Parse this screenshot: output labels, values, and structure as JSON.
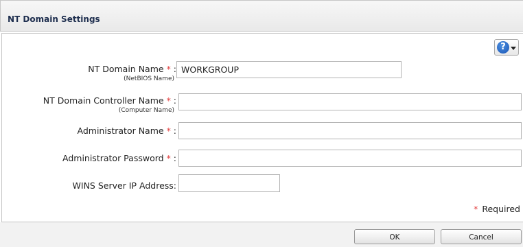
{
  "dialog": {
    "title": "NT Domain Settings"
  },
  "help": {
    "icon": "question-circle-icon",
    "glyph": "?"
  },
  "form": {
    "nt_domain_name": {
      "label": "NT Domain Name",
      "sub": "(NetBIOS Name)",
      "value": "WORKGROUP",
      "required": true
    },
    "nt_domain_controller_name": {
      "label": "NT Domain Controller Name",
      "sub": "(Computer Name)",
      "value": "",
      "required": true
    },
    "administrator_name": {
      "label": "Administrator Name",
      "value": "",
      "required": true
    },
    "administrator_password": {
      "label": "Administrator Password",
      "value": "",
      "required": true
    },
    "wins_server_ip": {
      "label": "WINS Server IP Address:",
      "value": "",
      "required": false
    },
    "required_star": "*",
    "label_suffix": " :",
    "required_note": "Required"
  },
  "footer": {
    "ok_label": "OK",
    "cancel_label": "Cancel"
  },
  "colors": {
    "required_star": "#e23b3b",
    "title_text": "#1f2f4f",
    "help_blue": "#1a55b5"
  }
}
